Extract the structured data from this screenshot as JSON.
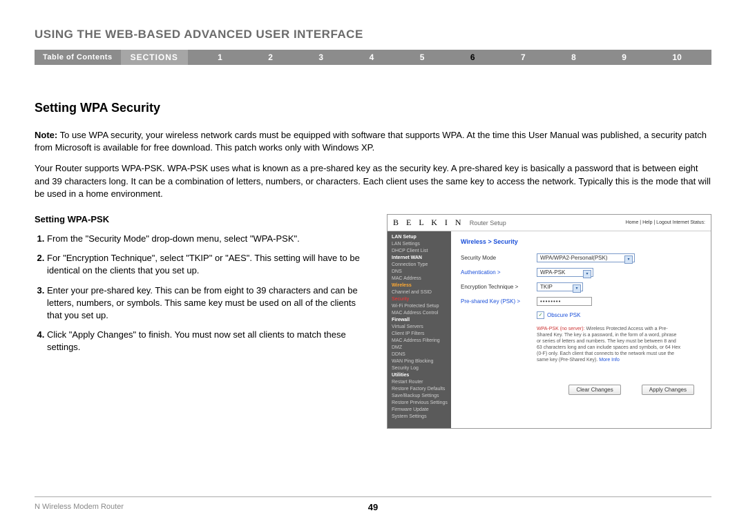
{
  "header": {
    "title": "USING THE WEB-BASED ADVANCED USER INTERFACE"
  },
  "nav": {
    "toc": "Table of Contents",
    "sections_label": "SECTIONS",
    "nums": [
      "1",
      "2",
      "3",
      "4",
      "5",
      "6",
      "7",
      "8",
      "9",
      "10"
    ],
    "active_index": 5
  },
  "main": {
    "section_title": "Setting WPA Security",
    "note_label": "Note:",
    "note_body": " To use WPA security, your wireless network cards must be equipped with software that supports WPA. At the time this User Manual was published, a security patch from Microsoft is available for free download. This patch works only with Windows XP.",
    "para2": "Your Router supports WPA-PSK. WPA-PSK uses what is known as a pre-shared key as the security key. A pre-shared key is basically a password that is between eight and 39 characters long. It can be a combination of letters, numbers, or characters. Each client uses the same key to access the network. Typically this is the mode that will be used in a home environment.",
    "sub_heading": "Setting WPA-PSK",
    "steps": [
      "From the \"Security Mode\" drop-down menu, select \"WPA-PSK\".",
      "For \"Encryption Technique\", select \"TKIP\" or \"AES\". This setting will have to be identical on the clients that you set up.",
      "Enter your pre-shared key. This can be from eight to 39 characters and can be letters, numbers, or symbols. This same key must be used on all of the clients that you set up.",
      "Click \"Apply Changes\" to finish. You must now set all clients to match these settings."
    ]
  },
  "router": {
    "logo": "B E L K I N",
    "subtitle": "Router Setup",
    "header_right": "Home | Help | Logout    Internet Status:",
    "sidebar": [
      {
        "t": "LAN Setup",
        "c": "sb-bold"
      },
      {
        "t": "LAN Settings",
        "c": ""
      },
      {
        "t": "DHCP Client List",
        "c": ""
      },
      {
        "t": "Internet WAN",
        "c": "sb-bold"
      },
      {
        "t": "Connection Type",
        "c": ""
      },
      {
        "t": "DNS",
        "c": ""
      },
      {
        "t": "MAC Address",
        "c": ""
      },
      {
        "t": "Wireless",
        "c": "sb-orange"
      },
      {
        "t": "Channel and SSID",
        "c": ""
      },
      {
        "t": "Security",
        "c": "sb-red"
      },
      {
        "t": "Wi-Fi Protected Setup",
        "c": ""
      },
      {
        "t": "MAC Address Control",
        "c": ""
      },
      {
        "t": "Firewall",
        "c": "sb-bold"
      },
      {
        "t": "Virtual Servers",
        "c": ""
      },
      {
        "t": "Client IP Filters",
        "c": ""
      },
      {
        "t": "MAC Address Filtering",
        "c": ""
      },
      {
        "t": "DMZ",
        "c": ""
      },
      {
        "t": "DDNS",
        "c": ""
      },
      {
        "t": "WAN Ping Blocking",
        "c": ""
      },
      {
        "t": "Security Log",
        "c": ""
      },
      {
        "t": "Utilities",
        "c": "sb-bold"
      },
      {
        "t": "Restart Router",
        "c": ""
      },
      {
        "t": "Restore Factory Defaults",
        "c": ""
      },
      {
        "t": "Save/Backup Settings",
        "c": ""
      },
      {
        "t": "Restore Previous Settings",
        "c": ""
      },
      {
        "t": "Firmware Update",
        "c": ""
      },
      {
        "t": "System Settings",
        "c": ""
      }
    ],
    "breadcrumb": "Wireless > Security",
    "labels": {
      "security_mode": "Security Mode",
      "authentication": "Authentication >",
      "encryption": "Encryption Technique >",
      "psk": "Pre-shared Key (PSK) >"
    },
    "values": {
      "security_mode": "WPA/WPA2-Personal(PSK)",
      "authentication": "WPA-PSK",
      "encryption": "TKIP",
      "psk": "••••••••"
    },
    "obscure_label": "Obscure PSK",
    "desc_strong": "WPA-PSK (no server):",
    "desc_body": " Wireless Protected Access with a Pre-Shared Key. The key is a password, in the form of a word, phrase or series of letters and numbers. The key must be between 8 and 63 characters long and can include spaces and symbols, or 64 Hex (0-F) only. Each client that connects to the network must use the same key (Pre-Shared Key). ",
    "desc_link": "More Info",
    "btn_clear": "Clear Changes",
    "btn_apply": "Apply Changes"
  },
  "footer": {
    "left": "N Wireless Modem Router",
    "page": "49"
  }
}
